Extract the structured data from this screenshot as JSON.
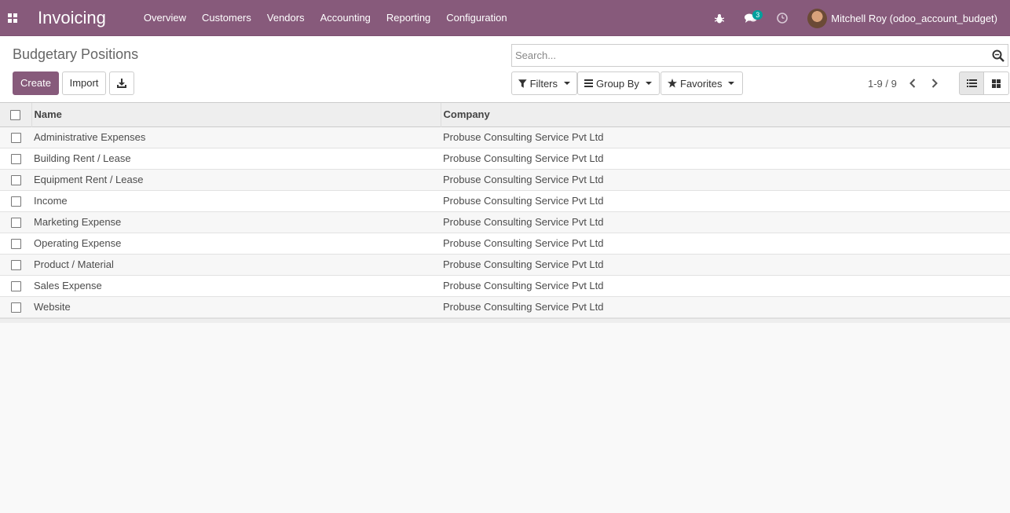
{
  "navbar": {
    "app_title": "Invoicing",
    "menu": [
      "Overview",
      "Customers",
      "Vendors",
      "Accounting",
      "Reporting",
      "Configuration"
    ],
    "messages_badge": "3",
    "user_name": "Mitchell Roy (odoo_account_budget)",
    "icons": [
      "apps-grid-icon",
      "bug-icon",
      "chat-icon",
      "clock-icon"
    ]
  },
  "control_panel": {
    "breadcrumb": "Budgetary Positions",
    "create_label": "Create",
    "import_label": "Import",
    "search_placeholder": "Search...",
    "filters_label": "Filters",
    "group_by_label": "Group By",
    "favorites_label": "Favorites",
    "pager": "1-9 / 9"
  },
  "table": {
    "headers": [
      "Name",
      "Company"
    ],
    "rows": [
      {
        "name": "Administrative Expenses",
        "company": "Probuse Consulting Service Pvt Ltd"
      },
      {
        "name": "Building Rent / Lease",
        "company": "Probuse Consulting Service Pvt Ltd"
      },
      {
        "name": "Equipment Rent / Lease",
        "company": "Probuse Consulting Service Pvt Ltd"
      },
      {
        "name": "Income",
        "company": "Probuse Consulting Service Pvt Ltd"
      },
      {
        "name": "Marketing Expense",
        "company": "Probuse Consulting Service Pvt Ltd"
      },
      {
        "name": "Operating Expense",
        "company": "Probuse Consulting Service Pvt Ltd"
      },
      {
        "name": "Product / Material",
        "company": "Probuse Consulting Service Pvt Ltd"
      },
      {
        "name": "Sales Expense",
        "company": "Probuse Consulting Service Pvt Ltd"
      },
      {
        "name": "Website",
        "company": "Probuse Consulting Service Pvt Ltd"
      }
    ]
  },
  "colors": {
    "brand": "#875a7b",
    "badge": "#00a09d"
  }
}
